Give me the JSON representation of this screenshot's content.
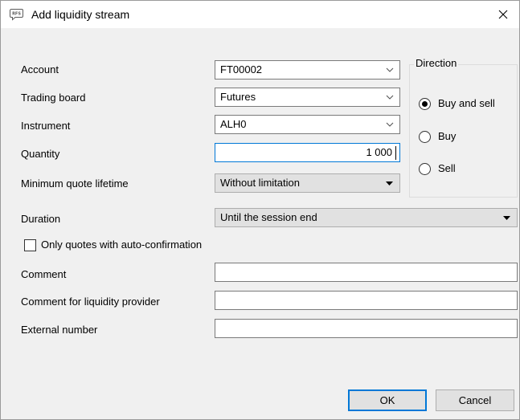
{
  "window": {
    "title": "Add liquidity stream",
    "icon": "rfs-app-icon",
    "close_icon": "close-icon"
  },
  "form": {
    "account": {
      "label": "Account",
      "value": "FT00002"
    },
    "trading_board": {
      "label": "Trading board",
      "value": "Futures"
    },
    "instrument": {
      "label": "Instrument",
      "value": "ALH0"
    },
    "quantity": {
      "label": "Quantity",
      "value": "1 000"
    },
    "min_quote_lifetime": {
      "label": "Minimum quote lifetime",
      "value": "Without limitation"
    },
    "duration": {
      "label": "Duration",
      "value": "Until the session end"
    },
    "auto_confirmation": {
      "label": "Only quotes with auto-confirmation",
      "checked": false
    },
    "comment": {
      "label": "Comment",
      "value": ""
    },
    "comment_lp": {
      "label": "Comment for liquidity provider",
      "value": ""
    },
    "external_number": {
      "label": "External number",
      "value": ""
    }
  },
  "direction": {
    "legend": "Direction",
    "options": [
      {
        "label": "Buy and sell",
        "selected": true
      },
      {
        "label": "Buy",
        "selected": false
      },
      {
        "label": "Sell",
        "selected": false
      }
    ]
  },
  "buttons": {
    "ok": "OK",
    "cancel": "Cancel"
  },
  "colors": {
    "focus_border": "#0078d7",
    "dialog_bg": "#f0f0f0",
    "titlebar_bg": "#ffffff"
  }
}
